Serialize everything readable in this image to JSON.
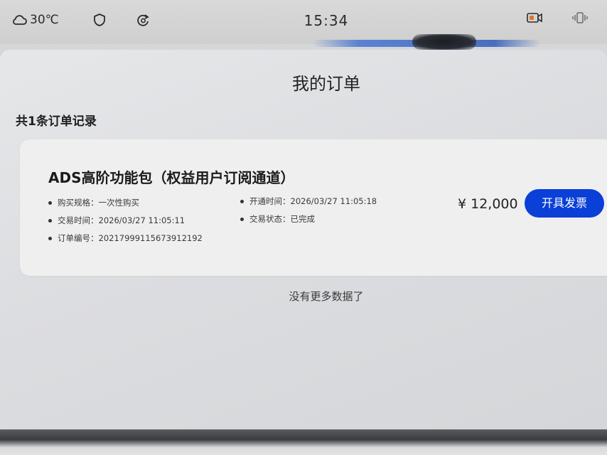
{
  "status_bar": {
    "temperature": "30℃",
    "time": "15:34",
    "icons": [
      "weather-icon",
      "shield-icon",
      "sync-icon",
      "camera-icon",
      "vibrate-icon"
    ]
  },
  "page": {
    "title": "我的订单",
    "record_count": "共1条订单记录",
    "no_more": "没有更多数据了"
  },
  "order": {
    "title": "ADS高阶功能包（权益用户订阅通道）",
    "purchase_spec_label": "购买规格：",
    "purchase_spec_value": "一次性购买",
    "trade_time_label": "交易时间：",
    "trade_time_value": "2026/03/27 11:05:11",
    "order_no_label": "订单编号：",
    "order_no_value": "20217999115673912192",
    "start_time_label": "开通时间：",
    "start_time_value": "2026/03/27 11:05:18",
    "trade_status_label": "交易状态：",
    "trade_status_value": "已完成",
    "price": "¥ 12,000",
    "invoice_button_label": "开具发票",
    "accent_color": "#0a3fd8"
  }
}
